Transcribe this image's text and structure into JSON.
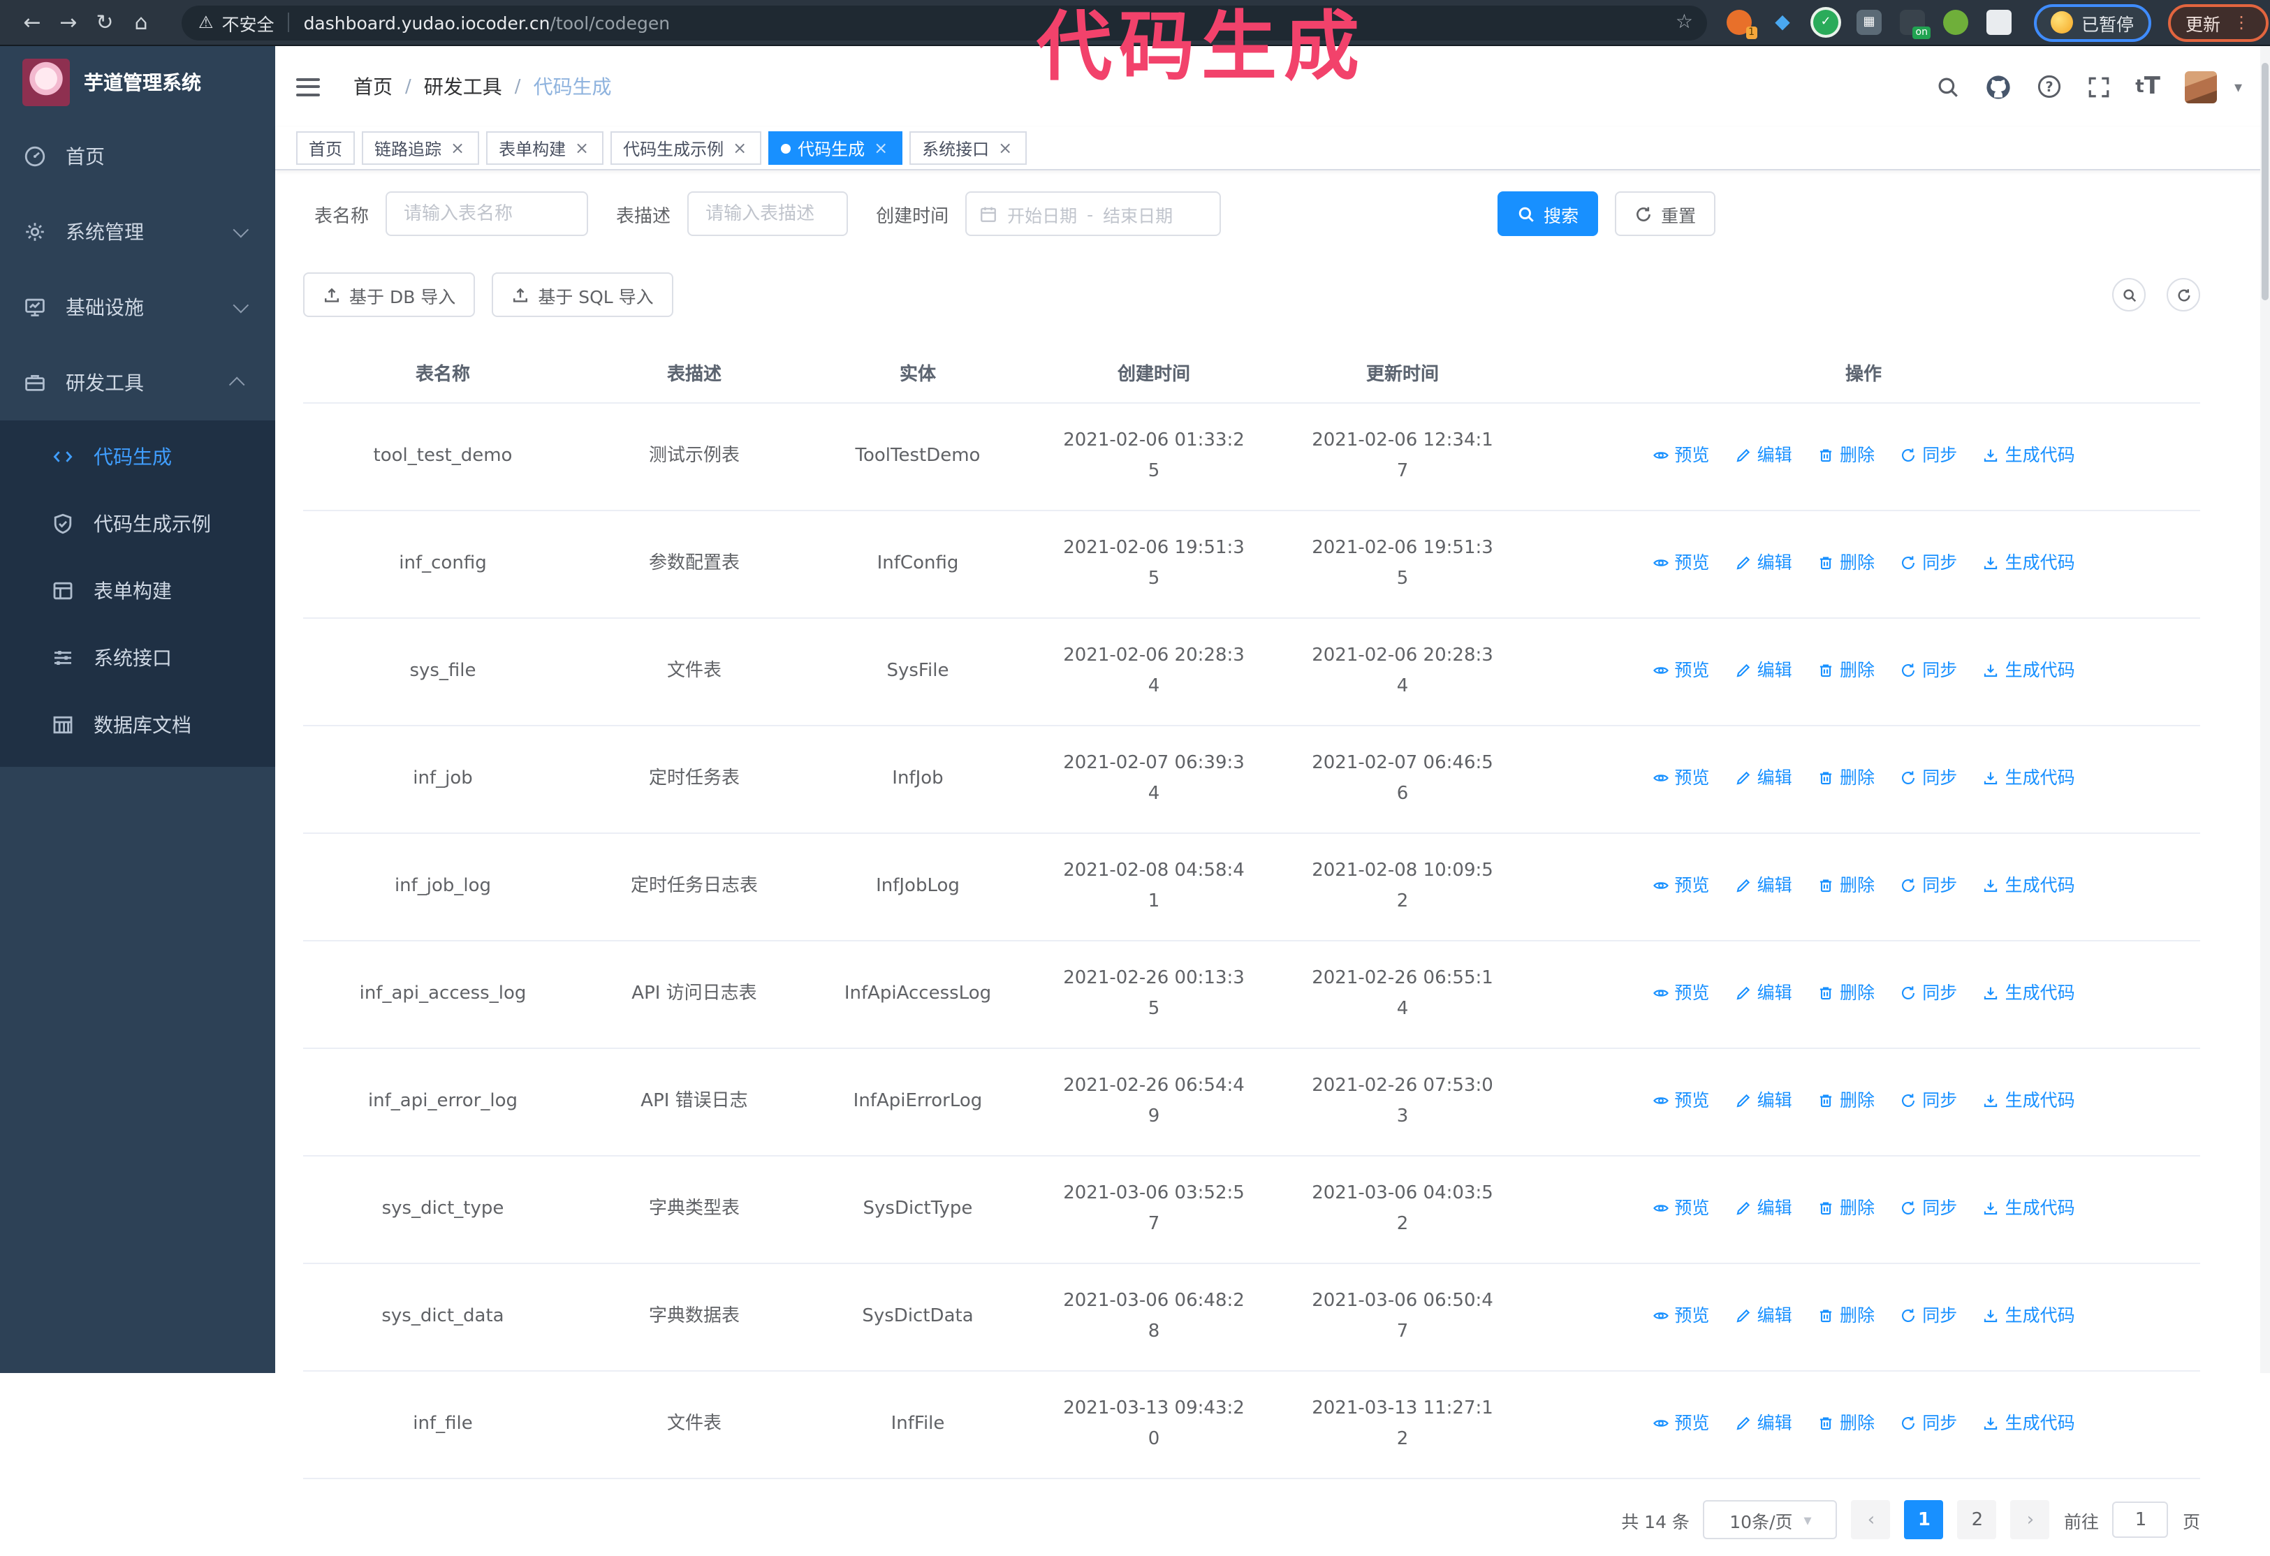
{
  "browser": {
    "security_label": "不安全",
    "url_host": "dashboard.yudao.iocoder.cn",
    "url_path": "/tool/codegen",
    "profile_status": "已暂停",
    "update_label": "更新"
  },
  "annotation": {
    "stamp": "代码生成",
    "stamp_color": "#f2426b"
  },
  "sidebar": {
    "title": "芋道管理系统",
    "items": [
      {
        "label": "首页",
        "icon": "dashboard-icon",
        "expanded": null
      },
      {
        "label": "系统管理",
        "icon": "gear-icon",
        "expanded": false
      },
      {
        "label": "基础设施",
        "icon": "infrastructure-icon",
        "expanded": false
      },
      {
        "label": "研发工具",
        "icon": "dev-tools-icon",
        "expanded": true
      }
    ],
    "submenu": [
      {
        "label": "代码生成",
        "icon": "code-icon",
        "active": true
      },
      {
        "label": "代码生成示例",
        "icon": "example-icon",
        "active": false
      },
      {
        "label": "表单构建",
        "icon": "form-builder-icon",
        "active": false
      },
      {
        "label": "系统接口",
        "icon": "api-icon",
        "active": false
      },
      {
        "label": "数据库文档",
        "icon": "db-doc-icon",
        "active": false
      }
    ]
  },
  "header": {
    "breadcrumb": [
      "首页",
      "研发工具",
      "代码生成"
    ]
  },
  "tabs": [
    {
      "label": "首页",
      "closable": false,
      "active": false
    },
    {
      "label": "链路追踪",
      "closable": true,
      "active": false
    },
    {
      "label": "表单构建",
      "closable": true,
      "active": false
    },
    {
      "label": "代码生成示例",
      "closable": true,
      "active": false
    },
    {
      "label": "代码生成",
      "closable": true,
      "active": true
    },
    {
      "label": "系统接口",
      "closable": true,
      "active": false
    }
  ],
  "search": {
    "name_label": "表名称",
    "name_placeholder": "请输入表名称",
    "desc_label": "表描述",
    "desc_placeholder": "请输入表描述",
    "time_label": "创建时间",
    "start_placeholder": "开始日期",
    "range_separator": "-",
    "end_placeholder": "结束日期",
    "search_label": "搜索",
    "reset_label": "重置"
  },
  "toolbar": {
    "import_db": "基于 DB 导入",
    "import_sql": "基于 SQL 导入"
  },
  "table": {
    "columns": [
      "表名称",
      "表描述",
      "实体",
      "创建时间",
      "更新时间",
      "操作"
    ],
    "actions": [
      "预览",
      "编辑",
      "删除",
      "同步",
      "生成代码"
    ],
    "rows": [
      {
        "name": "tool_test_demo",
        "desc": "测试示例表",
        "entity": "ToolTestDemo",
        "create_time": "2021-02-06 01:33:25",
        "update_time": "2021-02-06 12:34:17"
      },
      {
        "name": "inf_config",
        "desc": "参数配置表",
        "entity": "InfConfig",
        "create_time": "2021-02-06 19:51:35",
        "update_time": "2021-02-06 19:51:35"
      },
      {
        "name": "sys_file",
        "desc": "文件表",
        "entity": "SysFile",
        "create_time": "2021-02-06 20:28:34",
        "update_time": "2021-02-06 20:28:34"
      },
      {
        "name": "inf_job",
        "desc": "定时任务表",
        "entity": "InfJob",
        "create_time": "2021-02-07 06:39:34",
        "update_time": "2021-02-07 06:46:56"
      },
      {
        "name": "inf_job_log",
        "desc": "定时任务日志表",
        "entity": "InfJobLog",
        "create_time": "2021-02-08 04:58:41",
        "update_time": "2021-02-08 10:09:52"
      },
      {
        "name": "inf_api_access_log",
        "desc": "API 访问日志表",
        "entity": "InfApiAccessLog",
        "create_time": "2021-02-26 00:13:35",
        "update_time": "2021-02-26 06:55:14"
      },
      {
        "name": "inf_api_error_log",
        "desc": "API 错误日志",
        "entity": "InfApiErrorLog",
        "create_time": "2021-02-26 06:54:49",
        "update_time": "2021-02-26 07:53:03"
      },
      {
        "name": "sys_dict_type",
        "desc": "字典类型表",
        "entity": "SysDictType",
        "create_time": "2021-03-06 03:52:57",
        "update_time": "2021-03-06 04:03:52"
      },
      {
        "name": "sys_dict_data",
        "desc": "字典数据表",
        "entity": "SysDictData",
        "create_time": "2021-03-06 06:48:28",
        "update_time": "2021-03-06 06:50:47"
      },
      {
        "name": "inf_file",
        "desc": "文件表",
        "entity": "InfFile",
        "create_time": "2021-03-13 09:43:20",
        "update_time": "2021-03-13 11:27:12"
      }
    ]
  },
  "pagination": {
    "total": "共 14 条",
    "page_size": "10条/页",
    "pages": [
      "1",
      "2"
    ],
    "active_page": "1",
    "goto_label": "前往",
    "goto_value": "1",
    "unit_label": "页"
  },
  "colors": {
    "accent": "#1890ff",
    "sidebar_active": "#409eff",
    "stamp": "#f2426b"
  }
}
